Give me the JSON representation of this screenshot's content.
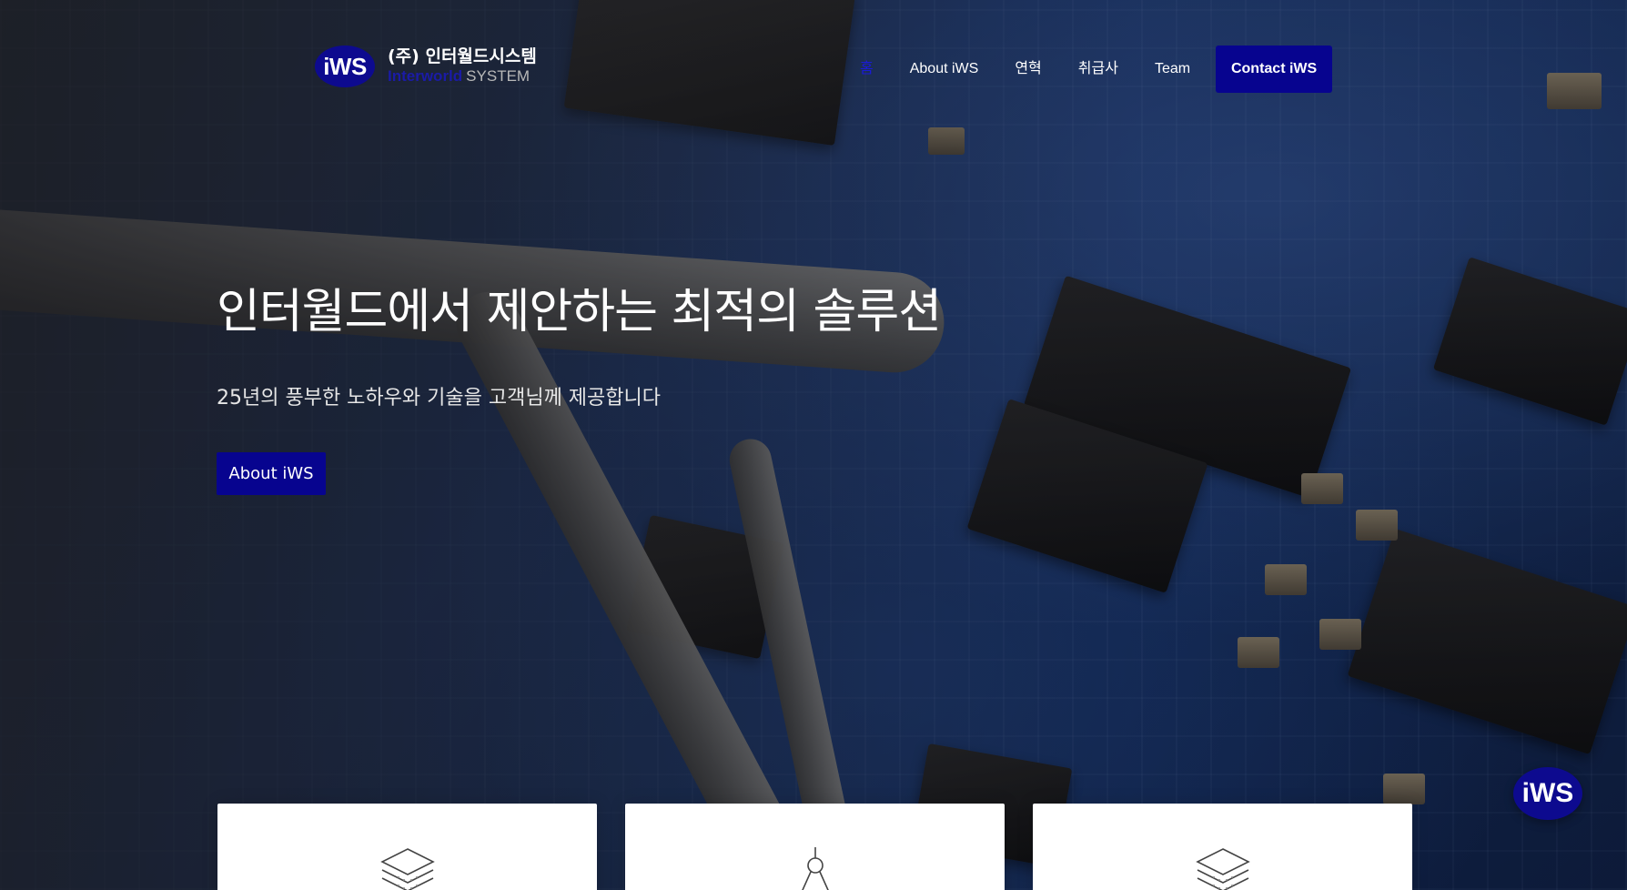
{
  "logo": {
    "badge_text": "iWS",
    "company_kr": "(주) 인터월드시스템",
    "company_en_main": "Interworld",
    "company_en_sub": "SYSTEM"
  },
  "nav": {
    "items": [
      {
        "label": "홈",
        "active": true
      },
      {
        "label": "About iWS",
        "active": false
      },
      {
        "label": "연혁",
        "active": false
      },
      {
        "label": "취급사",
        "active": false
      },
      {
        "label": "Team",
        "active": false
      }
    ],
    "contact_label": "Contact iWS"
  },
  "hero": {
    "title": "인터월드에서 제안하는 최적의 솔루션",
    "subtitle": "25년의 풍부한 노하우와 기술을 고객님께 제공합니다",
    "button_label": "About iWS"
  },
  "cards": [
    {
      "icon": "layers-icon"
    },
    {
      "icon": "compass-icon"
    },
    {
      "icon": "layers-icon"
    }
  ],
  "float_badge": {
    "text": "iWS"
  },
  "colors": {
    "brand_navy": "#07048f",
    "nav_active": "#1a1ad8",
    "text_white": "#ffffff"
  }
}
